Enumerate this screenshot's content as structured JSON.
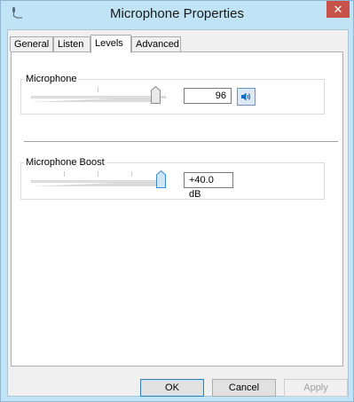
{
  "window": {
    "title": "Microphone Properties",
    "close_glyph": "✕"
  },
  "tabs": [
    {
      "label": "General",
      "active": false
    },
    {
      "label": "Listen",
      "active": false
    },
    {
      "label": "Levels",
      "active": true
    },
    {
      "label": "Advanced",
      "active": false
    }
  ],
  "levels": {
    "microphone": {
      "label": "Microphone",
      "value_text": "96",
      "level": 0.96,
      "icon": "speaker-volume-icon"
    },
    "boost": {
      "label": "Microphone Boost",
      "value_text": "+40.0 dB",
      "level": 1.0
    }
  },
  "buttons": {
    "ok": "OK",
    "cancel": "Cancel",
    "apply": "Apply"
  },
  "colors": {
    "accent": "#0e6cc5",
    "title_bg": "#c0e3f6",
    "close": "#c7524a"
  }
}
